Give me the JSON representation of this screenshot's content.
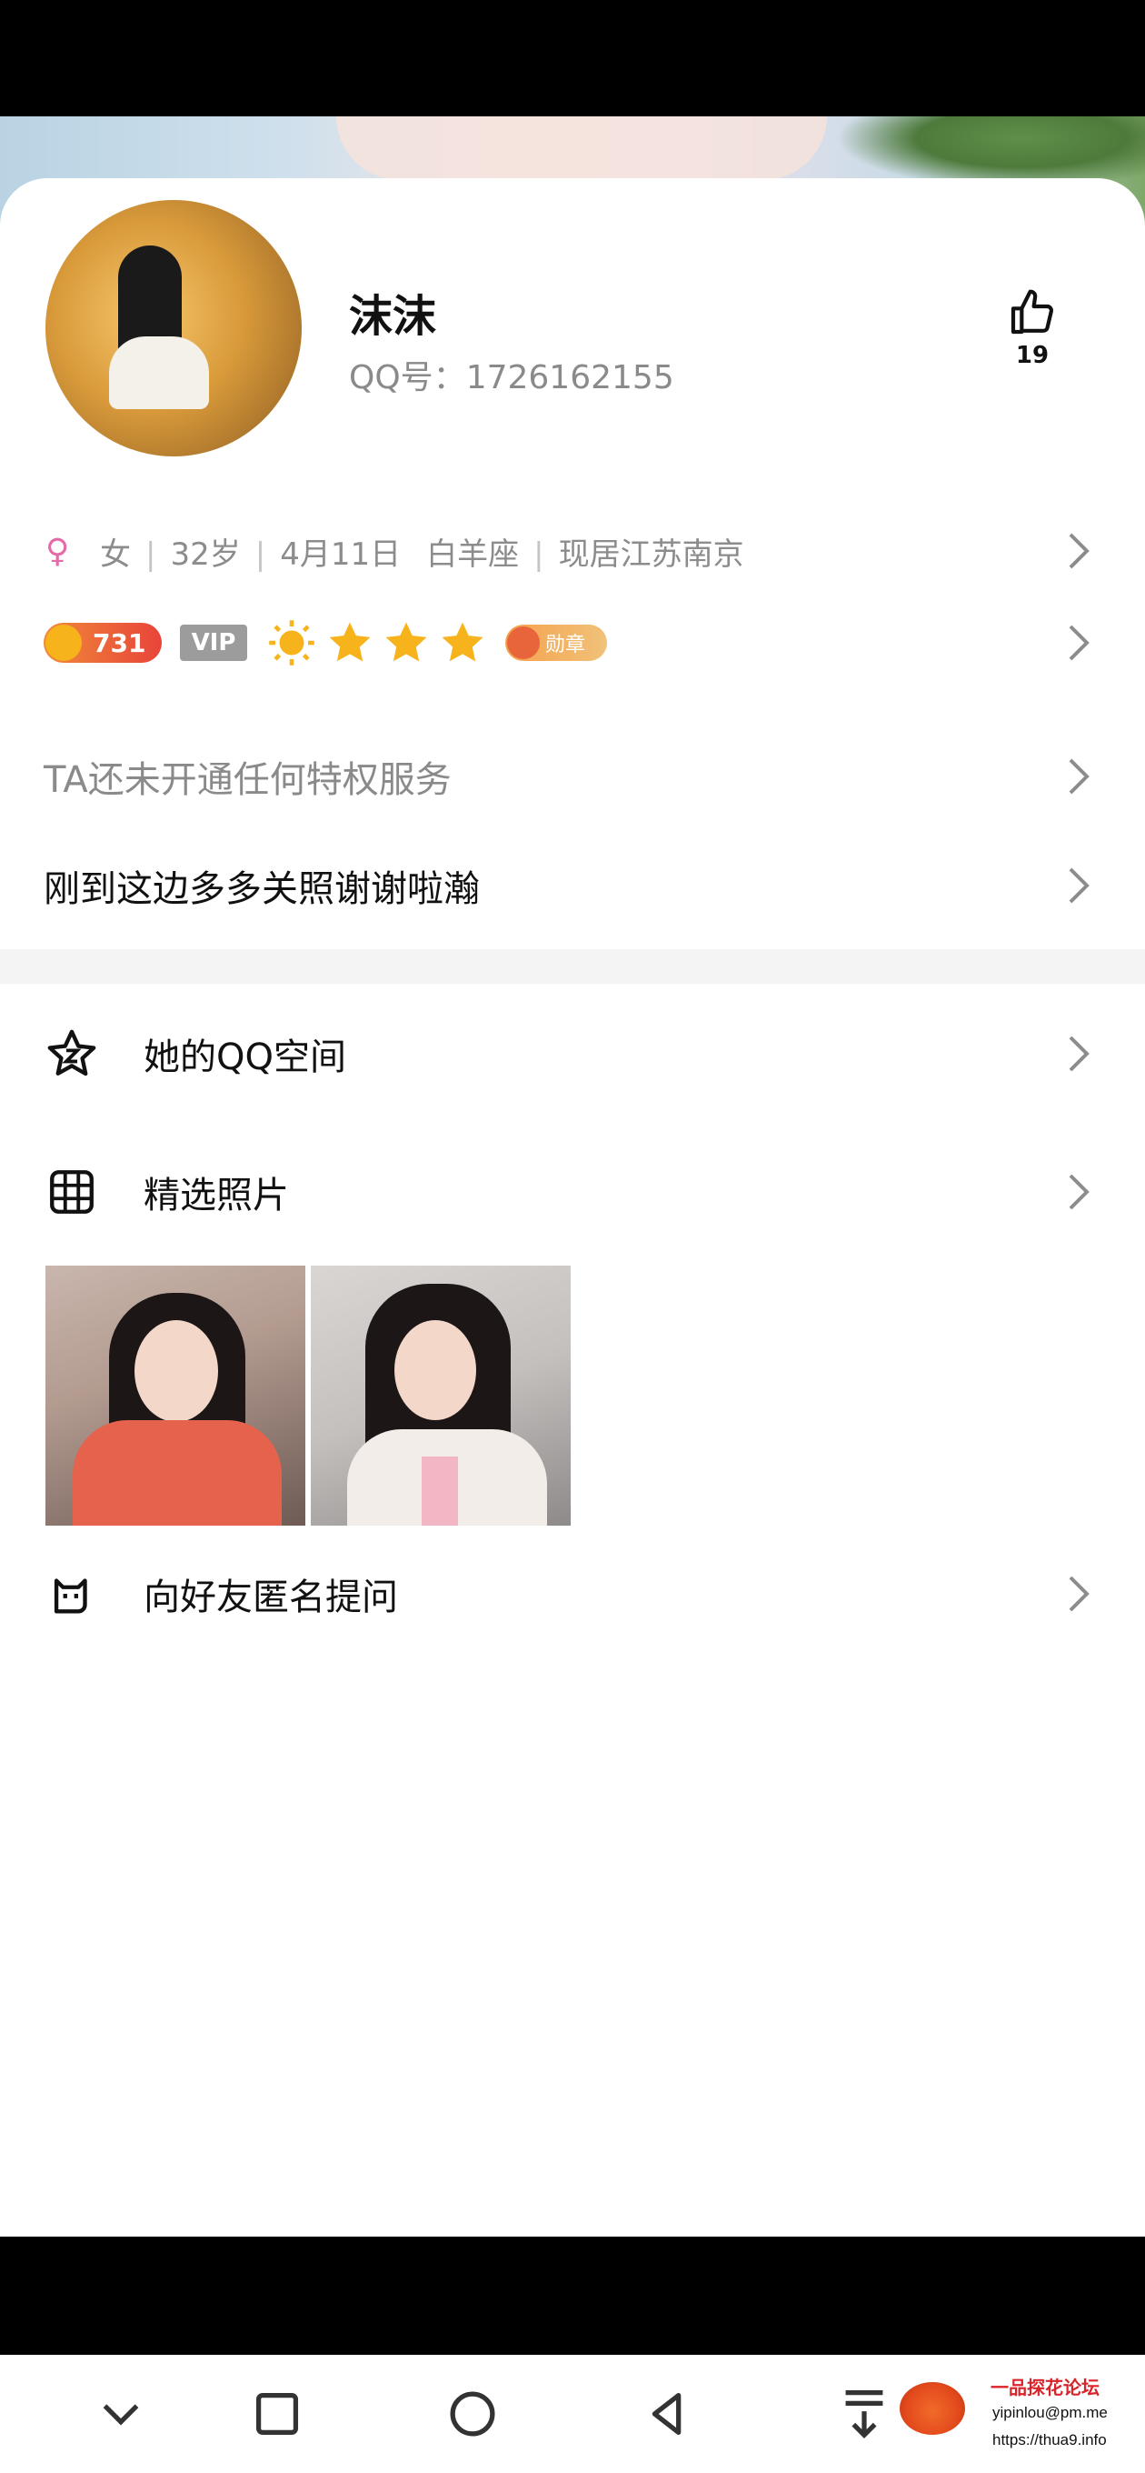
{
  "profile": {
    "nickname": "沫沫",
    "qq_label": "QQ号：",
    "qq_number": "1726162155",
    "like_count": "19"
  },
  "info": {
    "gender_icon": "♀",
    "gender": "女",
    "age": "32岁",
    "birthday": "4月11日",
    "zodiac": "白羊座",
    "location": "现居江苏南京",
    "separator": "|"
  },
  "badges": {
    "level": "731",
    "vip": "VIP",
    "medal": "勋章",
    "suns": 1,
    "stars": 3
  },
  "privilege_text": "TA还未开通任何特权服务",
  "signature": "刚到这边多多关照谢谢啦瀚",
  "menu": {
    "qzone": "她的QQ空间",
    "photos": "精选照片",
    "ask": "向好友匿名提问"
  },
  "watermark": {
    "title": "一品探花论坛",
    "email": "yipinlou@pm.me",
    "url": "https://thua9.info"
  },
  "colors": {
    "accent_pink": "#e46aa8",
    "level_red": "#e8443a",
    "star_gold": "#f6b31c"
  }
}
